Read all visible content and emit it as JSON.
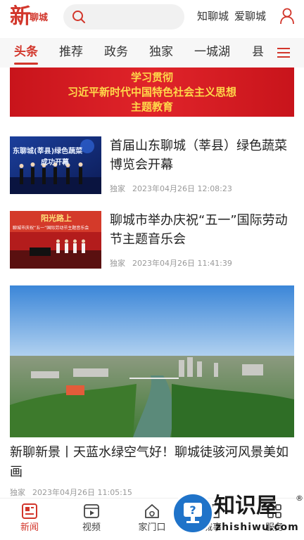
{
  "header": {
    "logo_big": "新",
    "logo_small": "聊城",
    "links": [
      "知聊城",
      "爱聊城"
    ]
  },
  "tabs": [
    {
      "label": "头条",
      "active": true
    },
    {
      "label": "推荐",
      "active": false
    },
    {
      "label": "政务",
      "active": false
    },
    {
      "label": "独家",
      "active": false
    },
    {
      "label": "一城湖",
      "active": false
    },
    {
      "label": "县",
      "active": false
    }
  ],
  "banner": {
    "line1": "学习贯彻",
    "line2": "习近平新时代中国特色社会主义思想",
    "line3": "主题教育"
  },
  "news": [
    {
      "title": "首届山东聊城（莘县）绿色蔬菜博览会开幕",
      "source": "独家",
      "time": "2023年04月26日 12:08:23",
      "thumb_text_1": "东聊城(莘县)绿色蔬菜",
      "thumb_text_2": "成功开幕"
    },
    {
      "title": "聊城市举办庆祝“五一”国际劳动节主题音乐会",
      "source": "独家",
      "time": "2023年04月26日 11:41:39",
      "thumb_text_1": "阳光路上",
      "thumb_text_2": "聊城市庆祝“五一”国际劳动节主题音乐会"
    }
  ],
  "big_news": {
    "title": "新聊新景丨天蓝水绿空气好！聊城徒骇河风景美如画",
    "source": "独家",
    "time": "2023年04月26日 11:05:15"
  },
  "bottom_nav": [
    {
      "label": "新闻",
      "icon": "news-icon",
      "active": true
    },
    {
      "label": "视频",
      "icon": "video-icon",
      "active": false
    },
    {
      "label": "家门口",
      "icon": "home-door-icon",
      "active": false
    },
    {
      "label": "城事",
      "icon": "city-icon",
      "active": false
    },
    {
      "label": "服务",
      "icon": "service-icon",
      "active": false
    }
  ],
  "watermark": {
    "text": "知识屋",
    "sub": "zhishiwu.com",
    "reg": "®"
  },
  "colors": {
    "accent": "#d2362b",
    "banner_red": "#d8202a",
    "banner_gold": "#ffd84a"
  }
}
